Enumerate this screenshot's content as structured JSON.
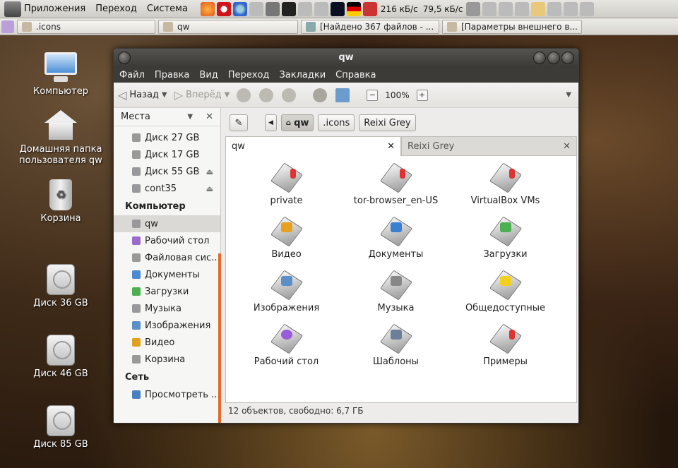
{
  "top_panel": {
    "menus": [
      "Приложения",
      "Переход",
      "Система"
    ],
    "net_down": "216 кБ/с",
    "net_up": "79,5 кБ/с"
  },
  "taskbar": {
    "tasks": [
      ".icons",
      "qw",
      "[Найдено 367 файлов - ...",
      "[Параметры внешнего в..."
    ]
  },
  "desktop": {
    "icons": [
      "Компьютер",
      "Домашняя папка пользователя qw",
      "Корзина",
      "Диск 36 GB",
      "Диск 46 GB",
      "Диск 85 GB"
    ]
  },
  "window": {
    "title": "qw",
    "menu": [
      "Файл",
      "Правка",
      "Вид",
      "Переход",
      "Закладки",
      "Справка"
    ],
    "toolbar": {
      "back": "Назад",
      "forward": "Вперёд",
      "zoom": "100%"
    },
    "sidebar": {
      "header": "Места",
      "devices": [
        "Диск 27 GB",
        "Диск 17 GB",
        "Диск 55 GB",
        "cont35"
      ],
      "computer_section": "Компьютер",
      "places": [
        "qw",
        "Рабочий стол",
        "Файловая сис...",
        "Документы",
        "Загрузки",
        "Музыка",
        "Изображения",
        "Видео",
        "Корзина"
      ],
      "network_section": "Сеть",
      "network": [
        "Просмотреть ..."
      ]
    },
    "pathbar": [
      "qw",
      ".icons",
      "Reixi Grey"
    ],
    "tabs": [
      "qw",
      "Reixi Grey"
    ],
    "files": [
      "private",
      "tor-browser_en-US",
      "VirtualBox VMs",
      "Видео",
      "Документы",
      "Загрузки",
      "Изображения",
      "Музыка",
      "Общедоступные",
      "Рабочий стол",
      "Шаблоны",
      "Примеры"
    ],
    "status": "12 объектов, свободно: 6,7 ГБ"
  },
  "colors": {
    "accent": "#e46a2a",
    "titlebar": "#3c3b37"
  }
}
